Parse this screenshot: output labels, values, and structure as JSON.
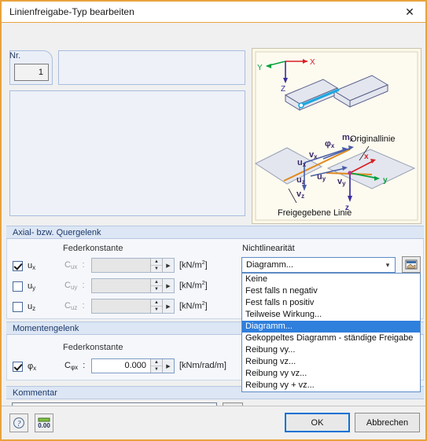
{
  "window": {
    "title": "Linienfreigabe-Typ bearbeiten",
    "close_icon": "close-icon",
    "border_color": "#e8a33d"
  },
  "header_form": {
    "nr_label": "Nr.",
    "nr_value": "1",
    "description_value": ""
  },
  "graphic": {
    "global_axis_x": "X",
    "global_axis_y": "Y",
    "global_axis_z": "Z",
    "local_axis_x": "x",
    "local_axis_y": "y",
    "local_axis_z": "z",
    "label_original_line": "Originallinie",
    "label_released_line": "Freigegebene Linie",
    "vectors": [
      "u",
      "x",
      "v",
      "x",
      "u",
      "y",
      "v",
      "y",
      "u",
      "z",
      "v",
      "z"
    ],
    "label_phi_x": "φ",
    "label_phi_x_sub": "x",
    "label_m_x": "m",
    "label_m_x_sub": "x",
    "label_ux": "u",
    "label_ux_sub": "x",
    "label_vx": "v",
    "label_vx_sub": "x",
    "label_uy": "u",
    "label_uy_sub": "y",
    "label_vy": "v",
    "label_vy_sub": "y",
    "label_uz": "u",
    "label_uz_sub": "z",
    "label_vz": "v",
    "label_vz_sub": "z"
  },
  "axial_section": {
    "title": "Axial- bzw. Quergelenk",
    "spring_column_header": "Federkonstante",
    "nonlinearity_header": "Nichtlinearität",
    "rows": [
      {
        "checkbox_label": "u",
        "checkbox_sub": "x",
        "checked": true,
        "spring_label": "C",
        "spring_sub": "ux",
        "colon": ":",
        "value": "",
        "unit": "[kN/m",
        "unit_sup": "2",
        "unit_end": "]",
        "enabled": false
      },
      {
        "checkbox_label": "u",
        "checkbox_sub": "y",
        "checked": false,
        "spring_label": "C",
        "spring_sub": "uy",
        "colon": ":",
        "value": "",
        "unit": "[kN/m",
        "unit_sup": "2",
        "unit_end": "]",
        "enabled": false
      },
      {
        "checkbox_label": "u",
        "checkbox_sub": "z",
        "checked": false,
        "spring_label": "C",
        "spring_sub": "uz",
        "colon": ":",
        "value": "",
        "unit": "[kN/m",
        "unit_sup": "2",
        "unit_end": "]",
        "enabled": false
      }
    ]
  },
  "nonlinearity": {
    "selected_value": "Diagramm...",
    "edit_button_icon": "table-edit-icon",
    "options": [
      "Keine",
      "Fest falls n negativ",
      "Fest falls n positiv",
      "Teilweise Wirkung...",
      "Diagramm...",
      "Gekoppeltes Diagramm - ständige Freigabe",
      "Reibung vy...",
      "Reibung vz...",
      "Reibung vy vz...",
      "Reibung vy + vz..."
    ],
    "selected_index": 4
  },
  "moment_section": {
    "title": "Momentengelenk",
    "spring_column_header": "Federkonstante",
    "row": {
      "checkbox_label": "φ",
      "checkbox_sub": "x",
      "checked": true,
      "spring_label": "C",
      "spring_sub": "φx",
      "colon": ":",
      "value": "0.000",
      "unit": "[kNm/rad/m]",
      "enabled": true
    }
  },
  "comment_section": {
    "title": "Kommentar",
    "value": "",
    "placeholder": "",
    "button_icon": "copy-pages-icon"
  },
  "footer": {
    "help_icon": "help-question-icon",
    "units_icon": "units-0.00-icon",
    "ok_label": "OK",
    "cancel_label": "Abbrechen",
    "ok_focus_color": "#0a72d4"
  }
}
